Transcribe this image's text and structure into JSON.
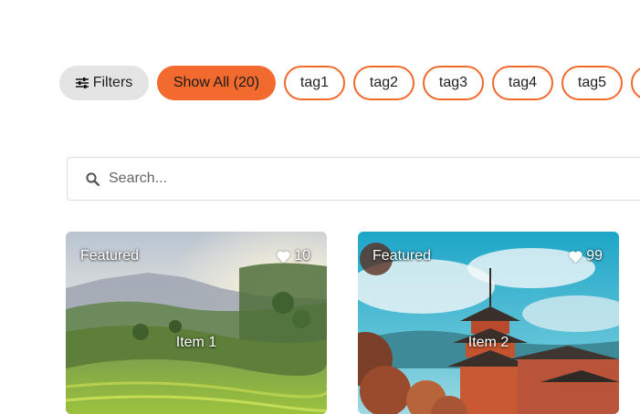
{
  "filters": {
    "filters_label": "Filters",
    "show_all_label": "Show All (20)",
    "tags": [
      "tag1",
      "tag2",
      "tag3",
      "tag4",
      "tag5"
    ],
    "accent_color": "#f26a2e",
    "filters_bg": "#e4e4e4"
  },
  "search": {
    "placeholder": "Search..."
  },
  "cards": [
    {
      "badge": "Featured",
      "likes": "10",
      "title": "Item 1"
    },
    {
      "badge": "Featured",
      "likes": "99",
      "title": "Item 2"
    }
  ]
}
